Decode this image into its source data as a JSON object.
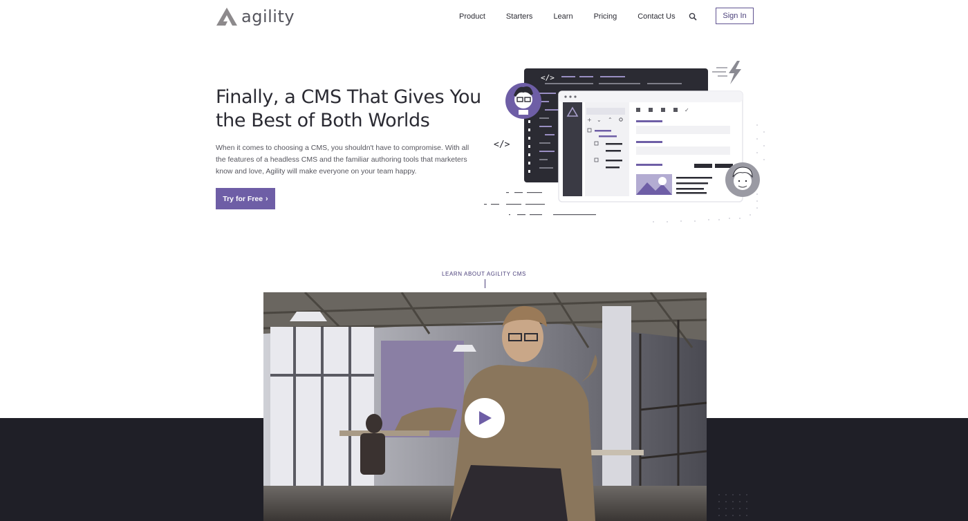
{
  "brand": {
    "name": "agility",
    "accent": "#6e5ea6",
    "dark": "#1f1f27"
  },
  "nav": {
    "items": [
      "Product",
      "Starters",
      "Learn",
      "Pricing",
      "Contact Us"
    ],
    "search_icon": "search-icon",
    "sign_in_label": "Sign In"
  },
  "hero": {
    "title": "Finally, a CMS That Gives You the Best of Both Worlds",
    "description": "When it comes to choosing a CMS, you shouldn't have to compromise. With all the features of a headless CMS and the familiar authoring tools that marketers know and love, Agility will make everyone on your team happy.",
    "cta_label": "Try for Free",
    "cta_icon": "chevron-right-icon",
    "illustration": {
      "code_tag": "</>",
      "icons": [
        "developer-avatar-icon",
        "marketer-avatar-icon",
        "lightning-icon",
        "code-icon"
      ]
    }
  },
  "video": {
    "label": "LEARN ABOUT AGILITY CMS",
    "play_icon": "play-icon"
  }
}
